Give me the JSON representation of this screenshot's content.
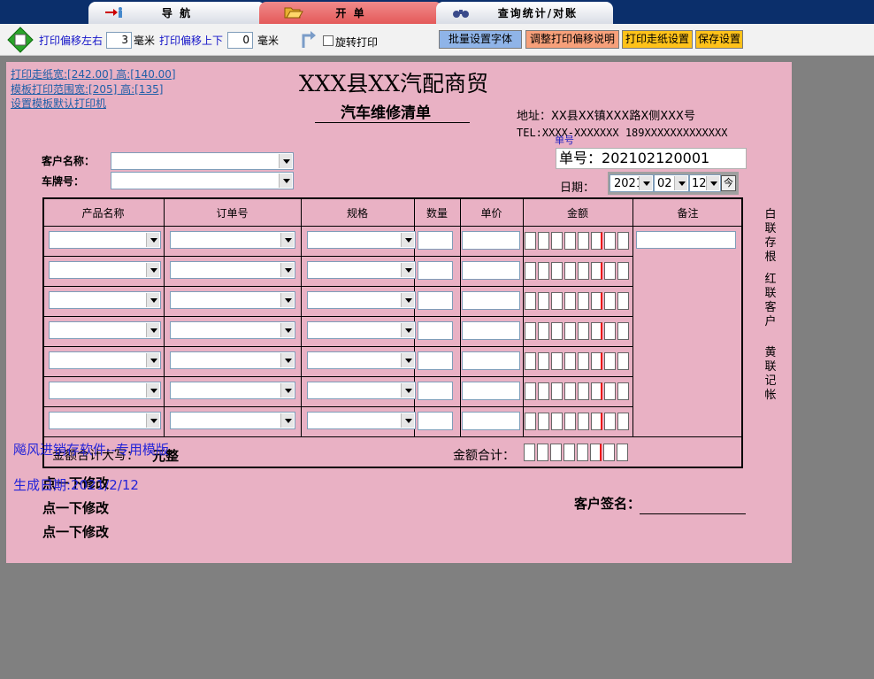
{
  "tabs": [
    {
      "label": "导 航",
      "icon": "arrow-person-icon"
    },
    {
      "label": "开 单",
      "icon": "open-folder-icon"
    },
    {
      "label": "查询统计/对账",
      "icon": "binoculars-icon"
    }
  ],
  "toolbar": {
    "offset_lr_label": "打印偏移左右",
    "offset_lr_value": "3",
    "unit1": "毫米",
    "offset_ud_label": "打印偏移上下",
    "offset_ud_value": "0",
    "unit2": "毫米",
    "rotate_label": "旋转打印",
    "btn_font": "批量设置字体",
    "btn_offset_help": "调整打印偏移说明",
    "btn_paper": "打印走纸设置",
    "btn_save": "保存设置",
    "colors": {
      "btn_font": "#8fb4e8",
      "btn_offset_help": "#f7a07a",
      "btn_paper": "#ffc21a",
      "btn_save": "#ffc21a"
    }
  },
  "template": {
    "paper_size": "打印走纸宽:[242.00] 高:[140.00]",
    "range": "模板打印范围宽:[205] 高:[135]",
    "default_printer": "设置模板默认打印机",
    "company": "XXX县XX汽配商贸",
    "doc_title": "汽车维修清单",
    "address": "地址：XX县XX镇XXX路X侧XXX号",
    "tel": "TEL:XXXX-XXXXXXX  189XXXXXXXXXXXXX",
    "order_tag": "单号",
    "order_label": "单号：",
    "order_no": "202102120001",
    "date_label": "日期：",
    "date_year": "2021",
    "date_month": "02",
    "date_day": "12",
    "today_btn": "今",
    "customer_label": "客户名称：",
    "plate_label": "车牌号：",
    "columns": [
      "产品名称",
      "订单号",
      "规格",
      "数量",
      "单价",
      "金额",
      "备注"
    ],
    "row_count": 7,
    "total_cn_label": "金额合计大写：",
    "total_cn_value": "元整",
    "total_label": "金额合计：",
    "watermark1": "飚风进销存软件--专用模版",
    "watermark2": "生成日期:2021/2/12",
    "editable_lines": [
      "点一下修改",
      "点一下修改",
      "点一下修改"
    ],
    "signature_label": "客户签名：",
    "copies": [
      "白联存根",
      "红联客户",
      "黄联记帐"
    ]
  }
}
